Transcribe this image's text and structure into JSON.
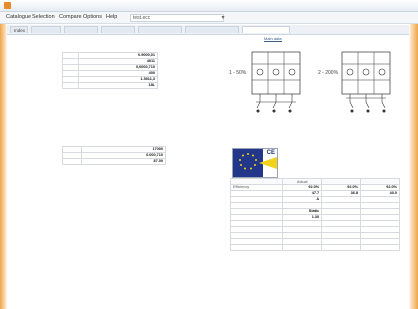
{
  "window": {
    "title": "",
    "brand": "",
    "accent_color": "#f0a54a",
    "active_tab_color": "#3a5a86"
  },
  "menu": {
    "items": [
      "Catalogue",
      "Selection",
      "Compare",
      "Options",
      "Help"
    ],
    "file_field": "test.ecc",
    "dropdown_icon": "chevron-down-icon"
  },
  "tabs": [
    "Index",
    "",
    "",
    "",
    "",
    "",
    ""
  ],
  "subtabs": [
    "",
    "",
    "",
    "Main data",
    "",
    ""
  ],
  "left_table": {
    "rows": [
      {
        "label": "",
        "value": "0.9000,01"
      },
      {
        "label": "",
        "value": "4011"
      },
      {
        "label": "",
        "value": "0,0000,710"
      },
      {
        "label": "",
        "value": "400"
      },
      {
        "label": "",
        "value": "1.5011,3"
      },
      {
        "label": "",
        "value": "18L"
      }
    ],
    "note": ""
  },
  "diagrams": {
    "left_label": "1 - 50%",
    "right_label": "2 - 200%"
  },
  "mid_table": {
    "rows": [
      {
        "label": "",
        "value": "17000"
      },
      {
        "label": "",
        "value": "0.000,710"
      },
      {
        "label": "",
        "value": "87.00"
      }
    ]
  },
  "badge": {
    "mark": "CE",
    "icon": "erp-label-icon",
    "colors": {
      "blue": "#23378a",
      "yellow": "#f3d21b"
    }
  },
  "efficiency_table": {
    "headers": [
      "",
      "Actual",
      "",
      ""
    ],
    "rows": [
      {
        "label": "Efficiency",
        "v1": "92.0%",
        "v2": "92.0%",
        "v3": "92.0%"
      },
      {
        "label": "",
        "v1": "47.7",
        "v2": "36.8",
        "v3": "40.0"
      },
      {
        "label": "",
        "v1": "A",
        "v2": "",
        "v3": ""
      },
      {
        "label": "",
        "v1": "",
        "v2": "",
        "v3": ""
      },
      {
        "label": "",
        "v1": "Static",
        "v2": "",
        "v3": ""
      },
      {
        "label": "",
        "v1": "1.30",
        "v2": "",
        "v3": ""
      },
      {
        "label": "",
        "v1": "",
        "v2": "",
        "v3": ""
      },
      {
        "label": "",
        "v1": "",
        "v2": "",
        "v3": ""
      },
      {
        "label": "",
        "v1": "",
        "v2": "",
        "v3": ""
      },
      {
        "label": "",
        "v1": "",
        "v2": "",
        "v3": ""
      },
      {
        "label": "",
        "v1": "",
        "v2": "",
        "v3": ""
      }
    ],
    "note": ""
  }
}
